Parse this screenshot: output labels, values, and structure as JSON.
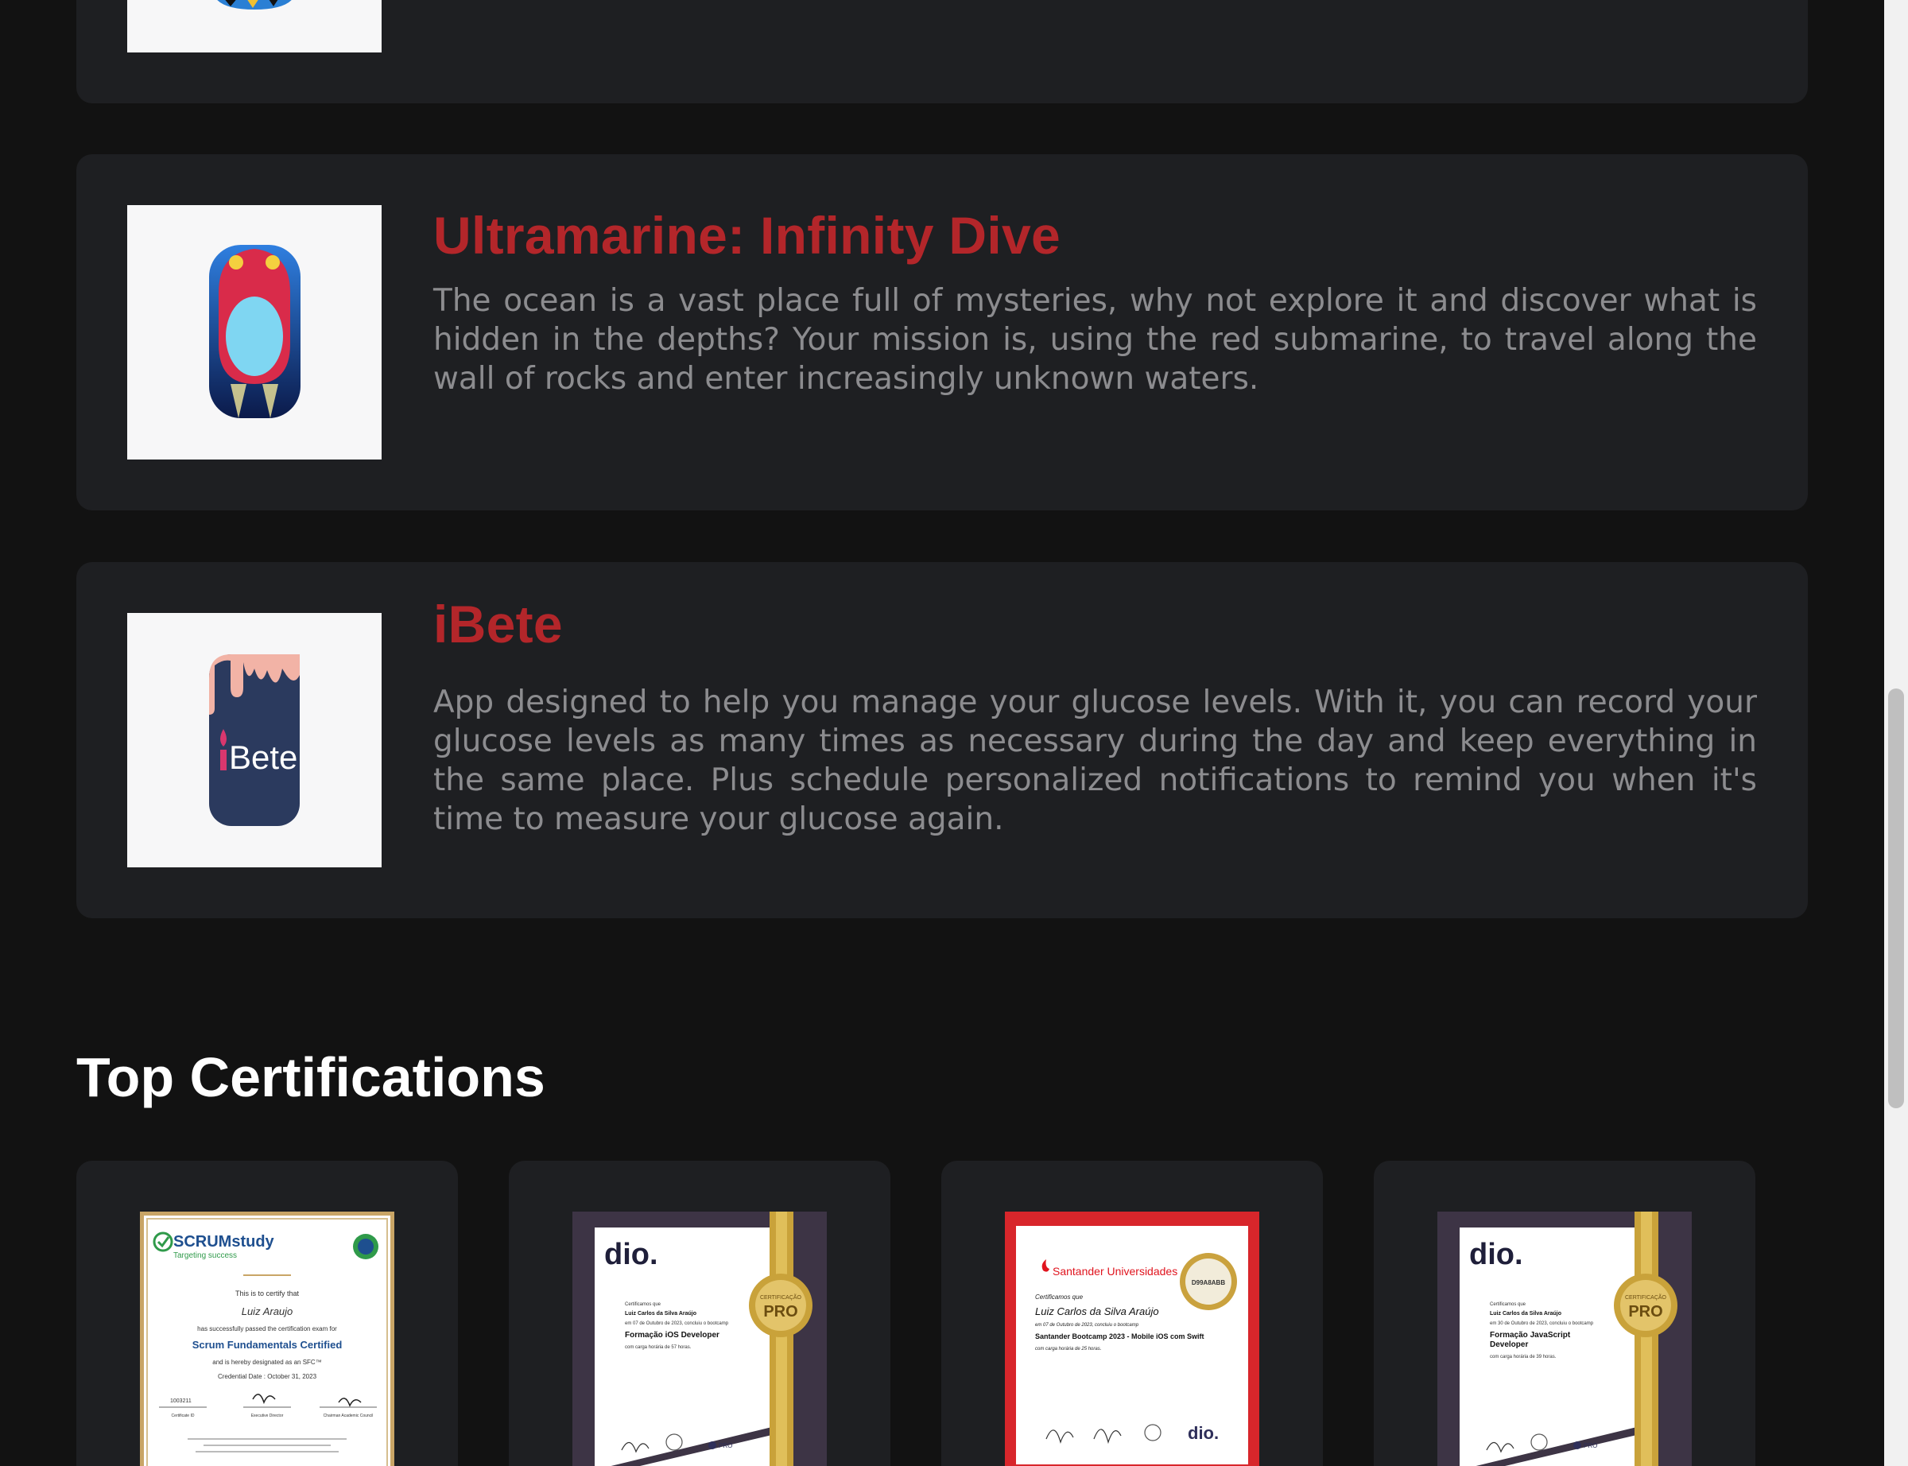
{
  "projects": [
    {
      "title": "",
      "description": "",
      "icon": "partial-app-icon"
    },
    {
      "title": "Ultramarine: Infinity Dive",
      "description": "The ocean is a vast place full of mysteries, why not explore it and discover what is hidden in the depths? Your mission is, using the red submarine, to travel along the wall of rocks and enter increasingly unknown waters.",
      "icon": "submarine-app-icon"
    },
    {
      "title": "iBete",
      "description": "App designed to help you manage your glucose levels. With it, you can record your glucose levels as many times as necessary during the day and keep everything in the same place. Plus schedule personalized notifications to remind you when it's time to measure your glucose again.",
      "icon": "ibete-app-icon",
      "icon_text": "Bete"
    }
  ],
  "certifications": {
    "title": "Top Certifications",
    "items": [
      {
        "brand": "SCRUMstudy",
        "tagline": "Targeting success",
        "certify_line": "This is to certify that",
        "name": "Luiz Araujo",
        "passed_line": "has successfully passed the certification exam for",
        "course": "Scrum Fundamentals Certified",
        "designated_line": "and is hereby designated as an SFC™",
        "date_line": "Credential Date : October 31, 2023",
        "cert_id": "1003211",
        "sig_labels": [
          "Certificate ID",
          "Executive Director",
          "Chairman Academic Council"
        ]
      },
      {
        "brand": "dio.",
        "intro": "Certificamos que",
        "name": "Luiz Carlos da Silva Araújo",
        "date_line": "em 07 de Outubro de 2023, concluiu o bootcamp",
        "course": "Formação iOS Developer",
        "hours": "com carga horária de 57 horas.",
        "seal_top": "CERTIFICAÇÃO",
        "seal": "PRO",
        "footer_mark": "PRO"
      },
      {
        "brand": "Santander Universidades",
        "code": "D99A8ABB",
        "intro": "Certificamos que",
        "name": "Luiz Carlos da Silva Araújo",
        "date_line": "em 07 de Outubro de 2023, concluiu o bootcamp",
        "course": "Santander Bootcamp 2023 - Mobile iOS com Swift",
        "hours": "com carga horária de 25 horas.",
        "footer_logo": "dio."
      },
      {
        "brand": "dio.",
        "intro": "Certificamos que",
        "name": "Luiz Carlos da Silva Araújo",
        "date_line": "em 30 de Outubro de 2023, concluiu o bootcamp",
        "course_line1": "Formação JavaScript",
        "course_line2": "Developer",
        "hours": "com carga horária de 39 horas.",
        "seal_top": "CERTIFICAÇÃO",
        "seal": "PRO",
        "footer_mark": "PRO"
      }
    ]
  },
  "colors": {
    "background": "#121212",
    "card": "#1e1f22",
    "accent_red": "#b3262a",
    "description_text": "#8c8c8f",
    "heading_text": "#ffffff"
  }
}
